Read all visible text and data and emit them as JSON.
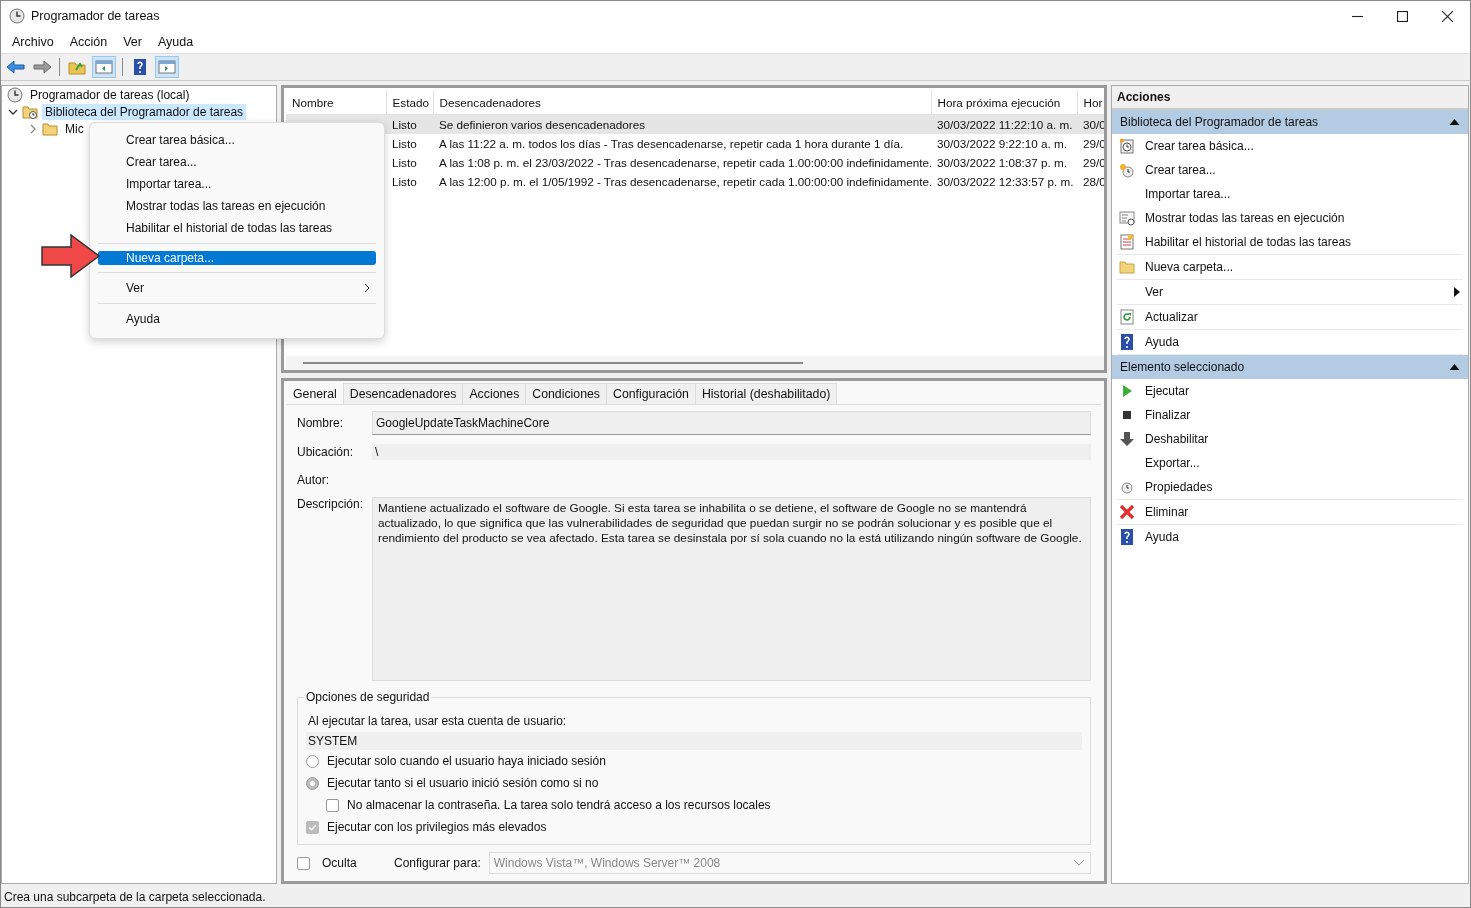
{
  "window": {
    "title": "Programador de tareas"
  },
  "menu_bar": [
    "Archivo",
    "Acción",
    "Ver",
    "Ayuda"
  ],
  "tree": [
    {
      "label": "Programador de tareas (local)",
      "selected": false,
      "children": [
        {
          "label": "Biblioteca del Programador de tareas",
          "expanded": true,
          "selected": true,
          "children": [
            {
              "label": "Mic",
              "expanded": false,
              "selected": false
            }
          ]
        }
      ]
    }
  ],
  "context_menu": {
    "groups": [
      [
        {
          "label": "Crear tarea básica...",
          "selected": false,
          "submenu": false
        },
        {
          "label": "Crear tarea...",
          "selected": false,
          "submenu": false
        },
        {
          "label": "Importar tarea...",
          "selected": false,
          "submenu": false
        },
        {
          "label": "Mostrar todas las tareas en ejecución",
          "selected": false,
          "submenu": false
        },
        {
          "label": "Habilitar el historial de todas las tareas",
          "selected": false,
          "submenu": false
        }
      ],
      [
        {
          "label": "Nueva carpeta...",
          "selected": true,
          "submenu": false
        }
      ],
      [
        {
          "label": "Ver",
          "selected": false,
          "submenu": true
        }
      ],
      [
        {
          "label": "Ayuda",
          "selected": false,
          "submenu": false
        }
      ]
    ]
  },
  "table": {
    "columns": [
      "Nombre",
      "Estado",
      "Desencadenadores",
      "Hora próxima ejecución",
      "Hor"
    ],
    "rows": [
      {
        "estado": "Listo",
        "desencadenadores": "Se definieron varios desencadenadores",
        "hora_proxima": "30/03/2022 11:22:10 a. m.",
        "column_5": "30/0",
        "selected": true
      },
      {
        "estado": "Listo",
        "desencadenadores": "A las 11:22 a. m. todos los días - Tras desencadenarse, repetir cada 1 hora durante 1 día.",
        "hora_proxima": "30/03/2022 9:22:10 a. m.",
        "column_5": "29/0",
        "selected": false
      },
      {
        "estado": "Listo",
        "desencadenadores": "A las 1:08 p. m. el 23/03/2022 - Tras desencadenarse, repetir cada 1.00:00:00 indefinidamente.",
        "hora_proxima": "30/03/2022 1:08:37 p. m.",
        "column_5": "29/0",
        "selected": false
      },
      {
        "estado": "Listo",
        "desencadenadores": "A las 12:00 p. m. el 1/05/1992 - Tras desencadenarse, repetir cada 1.00:00:00 indefinidamente.",
        "hora_proxima": "30/03/2022 12:33:57 p. m.",
        "column_5": "28/0",
        "selected": false
      }
    ]
  },
  "detail_tabs": [
    {
      "label": "General",
      "selected": true
    },
    {
      "label": "Desencadenadores",
      "selected": false
    },
    {
      "label": "Acciones",
      "selected": false
    },
    {
      "label": "Condiciones",
      "selected": false
    },
    {
      "label": "Configuración",
      "selected": false
    },
    {
      "label": "Historial (deshabilitado)",
      "selected": false
    }
  ],
  "general": {
    "nombre_label": "Nombre:",
    "nombre": "GoogleUpdateTaskMachineCore",
    "ubicacion_label": "Ubicación:",
    "ubicacion": "\\",
    "autor_label": "Autor:",
    "descripcion_label": "Descripción:",
    "descripcion": "Mantiene actualizado el software de Google. Si esta tarea se inhabilita o se detiene, el software de Google no se mantendrá actualizado, lo que significa que las vulnerabilidades de seguridad que puedan surgir no se podrán solucionar y es posible que el rendimiento del producto se vea afectado. Esta tarea se desinstala por sí sola cuando no la está utilizando ningún software de Google."
  },
  "security": {
    "title": "Opciones de seguridad",
    "account_label": "Al ejecutar la tarea, usar esta cuenta de usuario:",
    "account": "SYSTEM",
    "options": [
      {
        "kind": "radio",
        "label": "Ejecutar solo cuando el usuario haya iniciado sesión",
        "selected": false
      },
      {
        "kind": "radio",
        "label": "Ejecutar tanto si el usuario inició sesión como si no",
        "selected": true,
        "children": [
          {
            "kind": "checkbox",
            "label": "No almacenar la contraseña. La tarea solo tendrá acceso a los recursos locales",
            "checked": false
          }
        ]
      },
      {
        "kind": "checkbox",
        "label": "Ejecutar con los privilegios más elevados",
        "checked": true
      }
    ]
  },
  "hidden_option": {
    "label": "Oculta",
    "checked": false
  },
  "configure": {
    "label": "Configurar para:",
    "value": "Windows Vista™, Windows Server™ 2008"
  },
  "actions": {
    "title": "Acciones",
    "sections": [
      {
        "title": "Biblioteca del Programador de tareas",
        "expanded": true,
        "groups": [
          [
            {
              "label": "Crear tarea básica...",
              "submenu": false
            },
            {
              "label": "Crear tarea...",
              "submenu": false
            },
            {
              "label": "Importar tarea...",
              "submenu": false
            },
            {
              "label": "Mostrar todas las tareas en ejecución",
              "submenu": false
            },
            {
              "label": "Habilitar el historial de todas las tareas",
              "submenu": false
            }
          ],
          [
            {
              "label": "Nueva carpeta...",
              "submenu": false
            }
          ],
          [
            {
              "label": "Ver",
              "submenu": true
            }
          ],
          [
            {
              "label": "Actualizar",
              "submenu": false
            }
          ],
          [
            {
              "label": "Ayuda",
              "submenu": false
            }
          ]
        ]
      },
      {
        "title": "Elemento seleccionado",
        "expanded": true,
        "groups": [
          [
            {
              "label": "Ejecutar",
              "submenu": false
            },
            {
              "label": "Finalizar",
              "submenu": false
            },
            {
              "label": "Deshabilitar",
              "submenu": false
            },
            {
              "label": "Exportar...",
              "submenu": false
            },
            {
              "label": "Propiedades",
              "submenu": false
            }
          ],
          [
            {
              "label": "Eliminar",
              "submenu": false
            }
          ],
          [
            {
              "label": "Ayuda",
              "submenu": false
            }
          ]
        ]
      }
    ]
  },
  "status_bar": "Crea una subcarpeta de la carpeta seleccionada."
}
